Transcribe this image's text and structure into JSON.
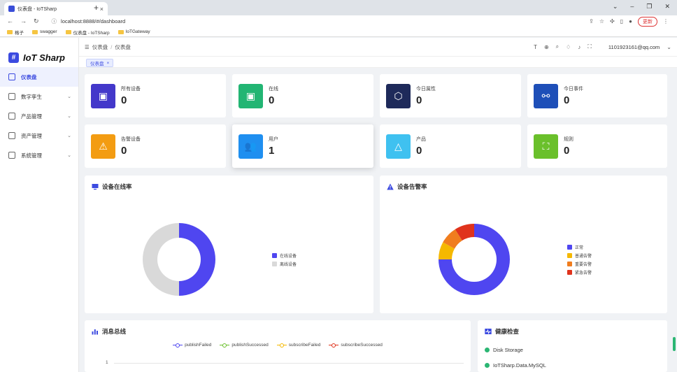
{
  "browser": {
    "tab_title": "仪表盘 - IoTSharp",
    "url": "localhost:8888/#/dashboard",
    "update_label": "更新",
    "bookmarks": [
      "格子",
      "swagger",
      "仪表盘 - IoTSharp",
      "IoTGateway"
    ]
  },
  "sidebar": {
    "app_title": "IoT Sharp",
    "items": [
      {
        "label": "仪表盘"
      },
      {
        "label": "数字孪生"
      },
      {
        "label": "产品管理"
      },
      {
        "label": "资产管理"
      },
      {
        "label": "系统管理"
      }
    ]
  },
  "header": {
    "breadcrumb": [
      "仪表盘",
      "仪表盘"
    ],
    "user": "1101923161@qq.com"
  },
  "tagsbar": {
    "tag": "仪表盘"
  },
  "stats": [
    {
      "label": "所有设备",
      "value": "0",
      "color": "#4338ca"
    },
    {
      "label": "在线",
      "value": "0",
      "color": "#22b573"
    },
    {
      "label": "今日属性",
      "value": "0",
      "color": "#1e2a5a"
    },
    {
      "label": "今日事件",
      "value": "0",
      "color": "#1e4fb8"
    },
    {
      "label": "告警设备",
      "value": "0",
      "color": "#f39c12"
    },
    {
      "label": "用户",
      "value": "1",
      "color": "#1f8ff0"
    },
    {
      "label": "产品",
      "value": "0",
      "color": "#3fc1f0"
    },
    {
      "label": "规则",
      "value": "0",
      "color": "#6ac02b"
    }
  ],
  "online_panel": {
    "title": "设备在线率"
  },
  "alarm_panel": {
    "title": "设备告警率"
  },
  "message_panel": {
    "title": "消息总线",
    "y_tick": "1"
  },
  "health_panel": {
    "title": "健康检查",
    "items": [
      "Disk Storage",
      "IoTSharp.Data.MySQL"
    ]
  },
  "chart_data": [
    {
      "type": "pie",
      "title": "设备在线率",
      "categories": [
        "在线设备",
        "离线设备"
      ],
      "values": [
        50,
        50
      ],
      "colors": [
        "#4f46f0",
        "#d9d9d9"
      ],
      "legend": "right"
    },
    {
      "type": "pie",
      "title": "设备告警率",
      "categories": [
        "正常",
        "普通告警",
        "重要告警",
        "紧急告警"
      ],
      "values": [
        75,
        8,
        8,
        9
      ],
      "colors": [
        "#4f46f0",
        "#f5b800",
        "#f07d1e",
        "#e0331c"
      ],
      "legend": "right"
    },
    {
      "type": "line",
      "title": "消息总线",
      "series": [
        {
          "name": "publishFailed",
          "color": "#4f46f0",
          "values": []
        },
        {
          "name": "publishSuccessed",
          "color": "#6ac02b",
          "values": []
        },
        {
          "name": "subscribeFailed",
          "color": "#f5b800",
          "values": []
        },
        {
          "name": "subscribeSuccessed",
          "color": "#e0331c",
          "values": []
        }
      ],
      "legend": "top"
    }
  ]
}
